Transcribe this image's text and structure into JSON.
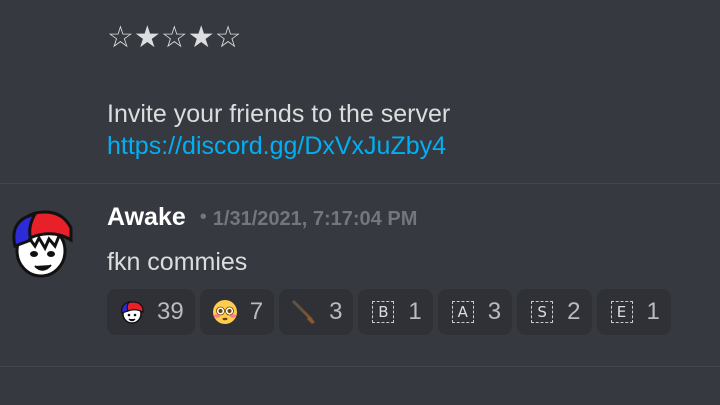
{
  "previous_message": {
    "rating_stars": [
      "☆",
      "★",
      "☆",
      "★",
      "☆"
    ],
    "invite_text": "Invite your friends to the server",
    "invite_link": "https://discord.gg/DxVxJuZby4"
  },
  "message": {
    "username": "Awake",
    "separator": "•",
    "timestamp": "1/31/2021, 7:17:04 PM",
    "content": "fkn commies"
  },
  "reactions": [
    {
      "emoji": "custom-face-emoji",
      "count": "39"
    },
    {
      "emoji": "flushed-face-emoji",
      "count": "7"
    },
    {
      "emoji": "rifle-emoji",
      "count": "3"
    },
    {
      "emoji": "letter-b-emoji",
      "letter": "B",
      "count": "1"
    },
    {
      "emoji": "letter-a-emoji",
      "letter": "A",
      "count": "3"
    },
    {
      "emoji": "letter-s-emoji",
      "letter": "S",
      "count": "2"
    },
    {
      "emoji": "letter-e-emoji",
      "letter": "E",
      "count": "1"
    }
  ],
  "colors": {
    "background": "#36393f",
    "link": "#00aff4",
    "reaction_bg": "#2f3136",
    "muted": "#72767d"
  }
}
